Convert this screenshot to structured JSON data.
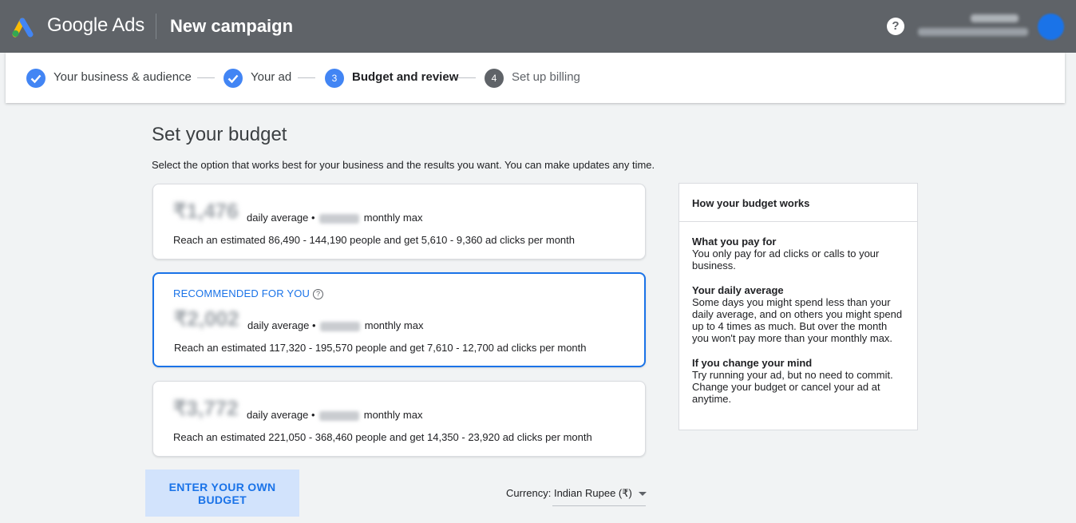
{
  "header": {
    "brand": "Google Ads",
    "title": "New campaign",
    "help_glyph": "?",
    "logo_colors": [
      "#fbbc04",
      "#4285f4",
      "#34a853"
    ],
    "bg_color": "#5f6368"
  },
  "stepper": {
    "steps": [
      {
        "label": "Your business & audience",
        "state": "done"
      },
      {
        "label": "Your ad",
        "state": "done"
      },
      {
        "label": "Budget and review",
        "state": "active",
        "number": "3"
      },
      {
        "label": "Set up billing",
        "state": "todo",
        "number": "4"
      }
    ]
  },
  "main": {
    "title": "Set your budget",
    "subtitle": "Select the option that works best for your business and the results you want. You can make updates any time."
  },
  "options": [
    {
      "amount": "₹1,476",
      "daily_text": "daily average •",
      "monthly_text": "monthly max",
      "reach": "Reach an estimated 86,490 - 144,190 people and get 5,610 - 9,360 ad clicks per month",
      "recommended": false
    },
    {
      "rec_label": "RECOMMENDED FOR YOU",
      "amount": "₹2,002",
      "daily_text": "daily average •",
      "monthly_text": "monthly max",
      "reach": "Reach an estimated 117,320 - 195,570 people and get 7,610 - 12,700 ad clicks per month",
      "recommended": true
    },
    {
      "amount": "₹3,772",
      "daily_text": "daily average •",
      "monthly_text": "monthly max",
      "reach": "Reach an estimated 221,050 - 368,460 people and get 14,350 - 23,920 ad clicks per month",
      "recommended": false
    }
  ],
  "info": {
    "title": "How your budget works",
    "sections": [
      {
        "heading": "What you pay for",
        "body": "You only pay for ad clicks or calls to your business."
      },
      {
        "heading": "Your daily average",
        "body": "Some days you might spend less than your daily average, and on others you might spend up to 4 times as much. But over the month you won't pay more than your monthly max."
      },
      {
        "heading": "If you change your mind",
        "body": "Try running your ad, but no need to commit. Change your budget or cancel your ad at anytime."
      }
    ]
  },
  "controls": {
    "own_budget_label": "ENTER YOUR OWN BUDGET",
    "currency_label": "Currency: Indian Rupee (₹)"
  },
  "colors": {
    "accent": "#1a73e8",
    "page_bg": "#f1f3f4"
  }
}
